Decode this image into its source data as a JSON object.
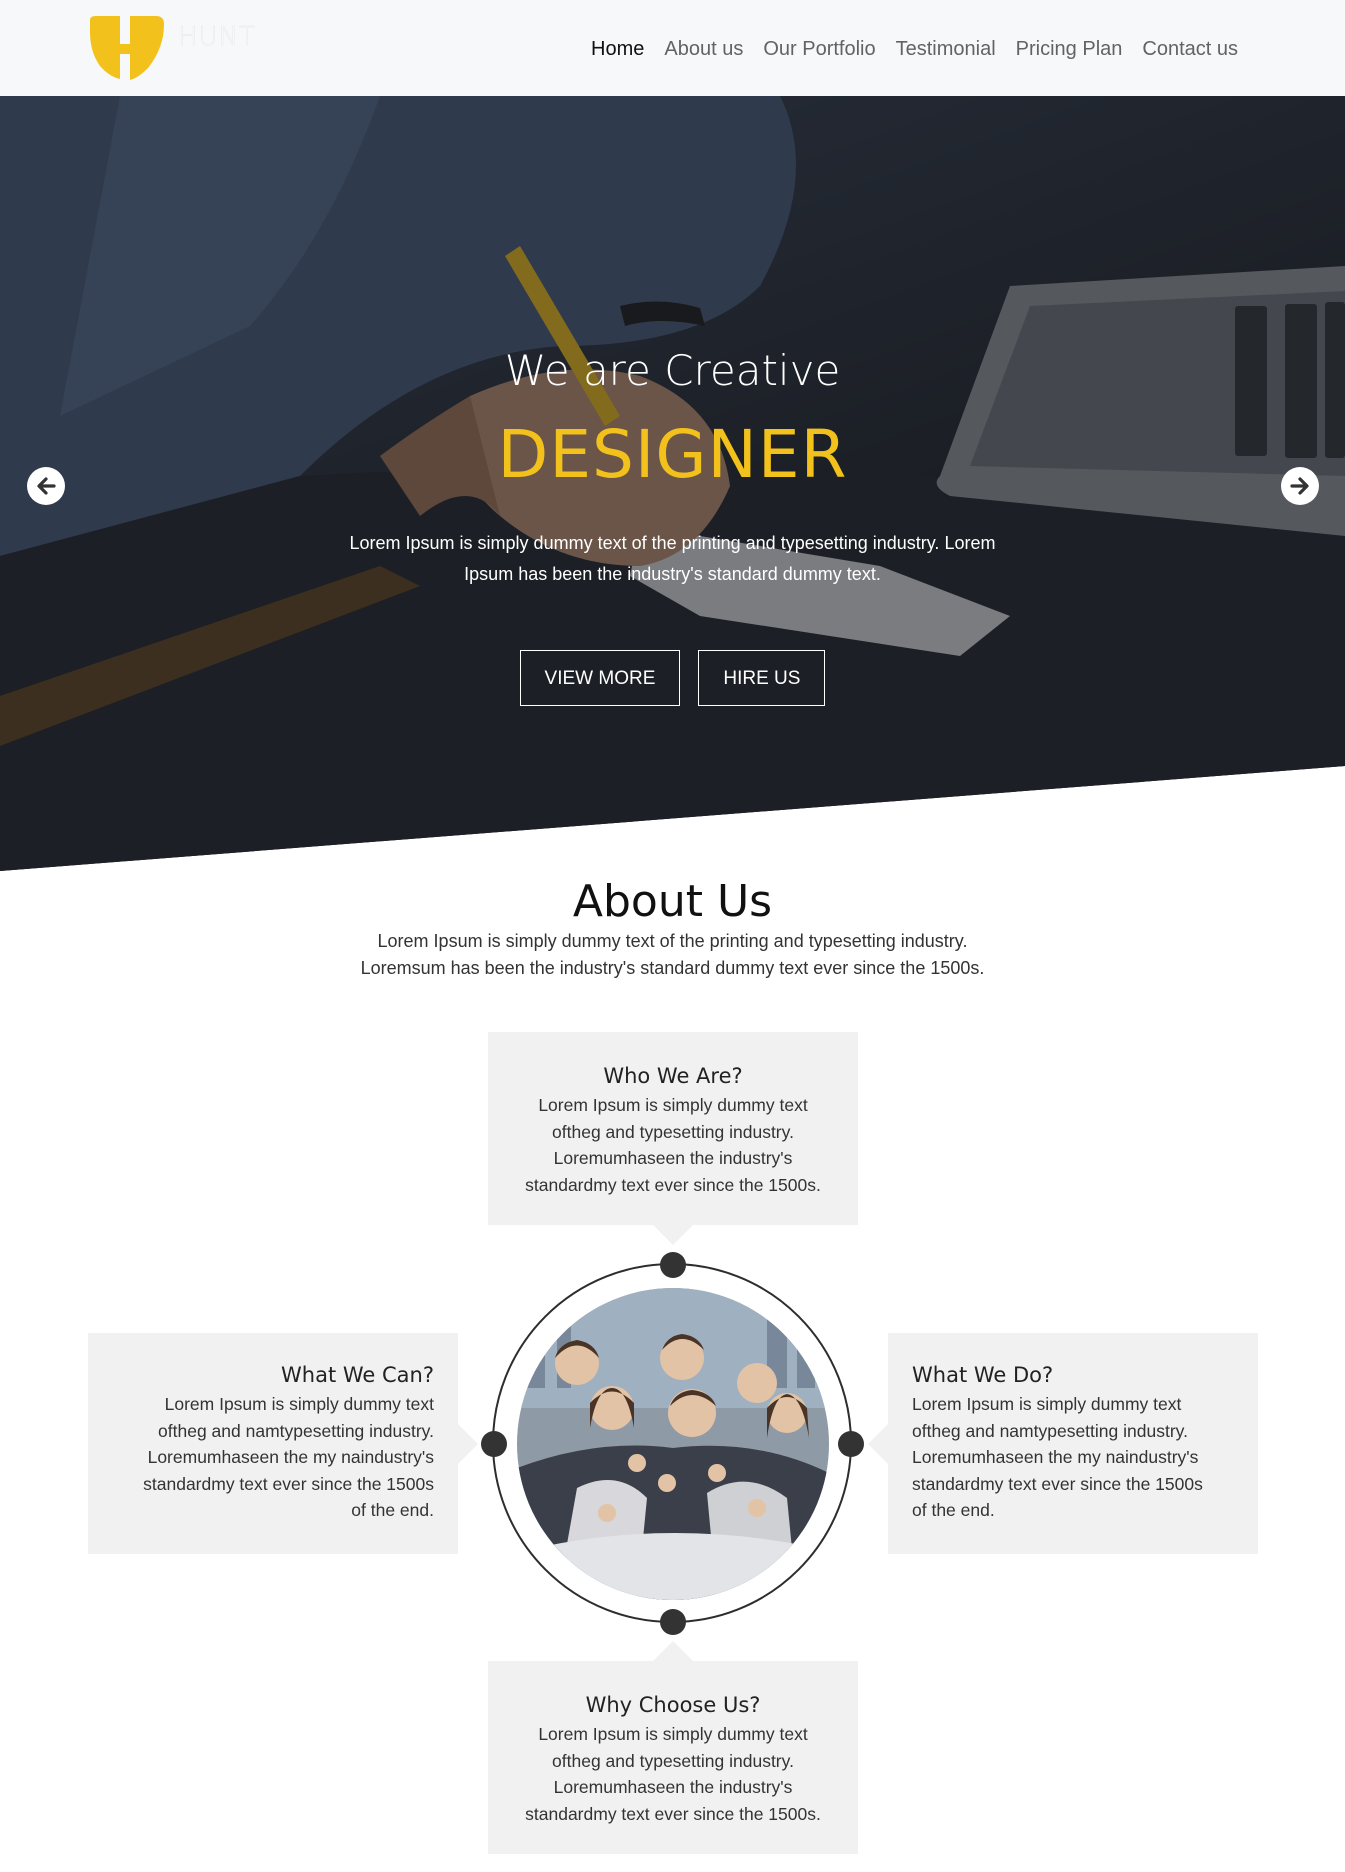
{
  "brand": {
    "logo_text": "HUNT",
    "accent_color": "#f3c11b"
  },
  "nav": {
    "items": [
      "Home",
      "About us",
      "Our Portfolio",
      "Testimonial",
      "Pricing Plan",
      "Contact us"
    ],
    "active": "Home"
  },
  "hero": {
    "line1": "We are Creative",
    "line2": "DESIGNER",
    "description": "Lorem Ipsum is simply dummy text of the printing and typesetting industry. Lorem Ipsum has been the industry's standard dummy text.",
    "view_more": "VIEW MORE",
    "hire_us": "HIRE US",
    "prev_icon": "arrow-left-icon",
    "next_icon": "arrow-right-icon"
  },
  "about": {
    "title": "About Us",
    "subtitle_line1": "Lorem Ipsum is simply dummy text of the printing and typesetting industry.",
    "subtitle_line2": "Loremsum has been the industry's standard dummy text ever since the 1500s.",
    "cards": {
      "who": {
        "title": "Who We Are?",
        "lines": [
          "Lorem Ipsum is simply dummy text",
          "oftheg and typesetting industry.",
          "Loremumhaseen the industry's",
          "standardmy text ever since the 1500s."
        ]
      },
      "can": {
        "title": "What We Can?",
        "lines": [
          "Lorem Ipsum is simply dummy text",
          "oftheg and namtypesetting industry.",
          "Loremumhaseen the my naindustry's",
          "standardmy text ever since the 1500s",
          "of the end."
        ]
      },
      "do": {
        "title": "What We Do?",
        "lines": [
          "Lorem Ipsum is simply dummy text",
          "oftheg and namtypesetting industry.",
          "Loremumhaseen the my naindustry's",
          "standardmy text ever since the 1500s",
          "of the end."
        ]
      },
      "why": {
        "title": "Why Choose Us?",
        "lines": [
          "Lorem Ipsum is simply dummy text",
          "oftheg and typesetting industry.",
          "Loremumhaseen the industry's",
          "standardmy text ever since the 1500s."
        ]
      }
    }
  }
}
